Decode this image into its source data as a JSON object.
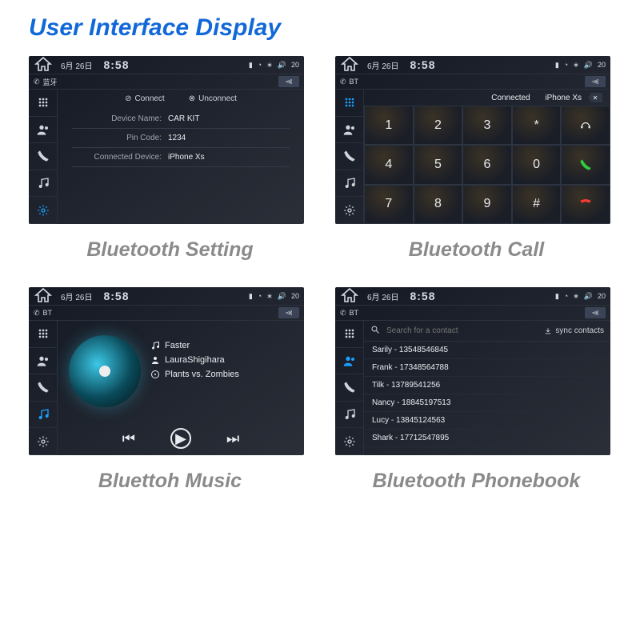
{
  "page_title": "User Interface Display",
  "status": {
    "date": "6月  26日",
    "time": "8:58",
    "volume": "20"
  },
  "subbar_labels": {
    "bt_cn": "蓝牙",
    "bt_en": "BT"
  },
  "captions": {
    "setting": "Bluetooth Setting",
    "call": "Bluetooth Call",
    "music": "Bluettoh Music",
    "phonebook": "Bluetooth  Phonebook"
  },
  "setting": {
    "connect": "Connect",
    "unconnect": "Unconnect",
    "rows": [
      {
        "k": "Device Name:",
        "v": "CAR KIT"
      },
      {
        "k": "Pin Code:",
        "v": "1234"
      },
      {
        "k": "Connected Device:",
        "v": "iPhone Xs"
      }
    ]
  },
  "call": {
    "connected_prefix": "Connected",
    "connected_device": "iPhone Xs",
    "keys": [
      "1",
      "2",
      "3",
      "*",
      "",
      "4",
      "5",
      "6",
      "0",
      "",
      "7",
      "8",
      "9",
      "#",
      ""
    ]
  },
  "music": {
    "title": "Faster",
    "artist": "LauraShigihara",
    "album": "Plants vs. Zombies"
  },
  "phonebook": {
    "placeholder": "Search for a contact",
    "sync": "sync contacts",
    "items": [
      "Sarily - 13548546845",
      "Frank - 17348564788",
      "Tilk - 13789541256",
      "Nancy - 18845197513",
      "Lucy - 13845124563",
      "Shark - 17712547895"
    ]
  }
}
